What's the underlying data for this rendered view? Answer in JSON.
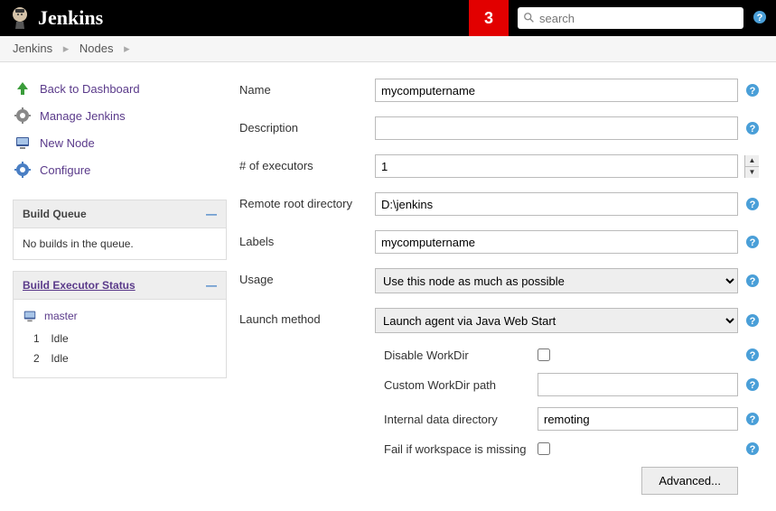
{
  "header": {
    "logo_text": "Jenkins",
    "notification_count": "3",
    "search_placeholder": "search"
  },
  "breadcrumbs": [
    "Jenkins",
    "Nodes"
  ],
  "sidebar": {
    "links": [
      {
        "label": "Back to Dashboard",
        "icon": "up-arrow"
      },
      {
        "label": "Manage Jenkins",
        "icon": "gear"
      },
      {
        "label": "New Node",
        "icon": "computer"
      },
      {
        "label": "Configure",
        "icon": "gear-blue"
      }
    ],
    "build_queue": {
      "title": "Build Queue",
      "empty_text": "No builds in the queue."
    },
    "executor_status": {
      "title": "Build Executor Status",
      "master_label": "master",
      "executors": [
        {
          "num": "1",
          "status": "Idle"
        },
        {
          "num": "2",
          "status": "Idle"
        }
      ]
    }
  },
  "form": {
    "name": {
      "label": "Name",
      "value": "mycomputername"
    },
    "description": {
      "label": "Description",
      "value": ""
    },
    "executors": {
      "label": "# of executors",
      "value": "1"
    },
    "remote_root": {
      "label": "Remote root directory",
      "value": "D:\\jenkins"
    },
    "labels": {
      "label": "Labels",
      "value": "mycomputername"
    },
    "usage": {
      "label": "Usage",
      "value": "Use this node as much as possible"
    },
    "launch_method": {
      "label": "Launch method",
      "value": "Launch agent via Java Web Start"
    },
    "sub": {
      "disable_workdir": {
        "label": "Disable WorkDir"
      },
      "custom_workdir": {
        "label": "Custom WorkDir path",
        "value": ""
      },
      "internal_dir": {
        "label": "Internal data directory",
        "value": "remoting"
      },
      "fail_missing": {
        "label": "Fail if workspace is missing"
      }
    },
    "advanced_label": "Advanced..."
  }
}
